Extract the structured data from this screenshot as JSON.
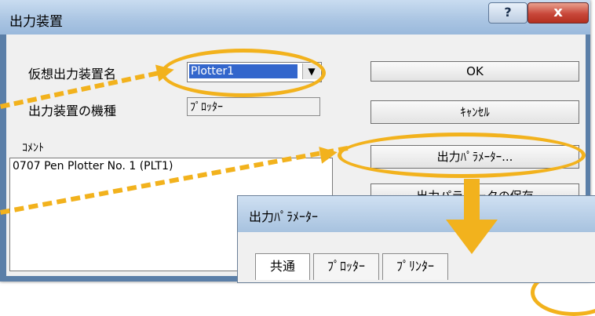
{
  "window": {
    "title": "出力装置",
    "help_label": "?",
    "close_label": "x"
  },
  "form": {
    "device_name_label": "仮想出力装置名",
    "device_name_value": "Plotter1",
    "model_label": "出力装置の機種",
    "model_value": "ﾌﾟﾛｯﾀｰ",
    "comment_label": "ｺﾒﾝﾄ",
    "comment_value": "0707 Pen Plotter No. 1 (PLT1)"
  },
  "buttons": {
    "ok": "OK",
    "cancel": "ｷｬﾝｾﾙ",
    "params": "出力ﾊﾟﾗﾒｰﾀｰ...",
    "partial": "出力パラメータの保存"
  },
  "subdialog": {
    "title": "出力ﾊﾟﾗﾒｰﾀｰ",
    "tabs": [
      "共通",
      "ﾌﾟﾛｯﾀｰ",
      "ﾌﾟﾘﾝﾀｰ"
    ]
  },
  "colors": {
    "accent": "#f2b21d",
    "selection": "#3366cc"
  },
  "icons": {
    "dropdown": "chevron-down-icon",
    "arrow": "arrow-down-icon"
  }
}
